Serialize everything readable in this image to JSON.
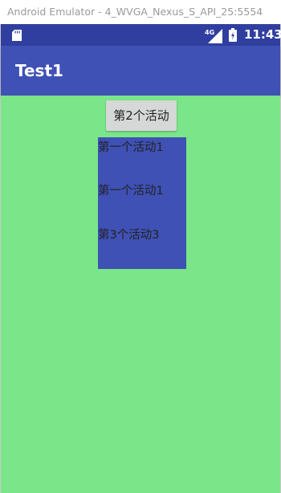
{
  "window": {
    "title": "Android Emulator - 4_WVGA_Nexus_S_API_25:5554"
  },
  "statusbar": {
    "time": "11:43",
    "network_label": "4G",
    "icons": [
      "sd-card-icon",
      "signal-icon",
      "battery-icon"
    ]
  },
  "appbar": {
    "title": "Test1"
  },
  "main": {
    "button_label": "第2个活动",
    "texts": [
      "第一个活动1",
      "第一个活动1",
      "第3个活动3"
    ]
  },
  "colors": {
    "statusbar": "#303f9f",
    "appbar": "#3f51b5",
    "background": "#7ae689",
    "panel": "#3f51b5",
    "button": "#d6d7d7"
  }
}
